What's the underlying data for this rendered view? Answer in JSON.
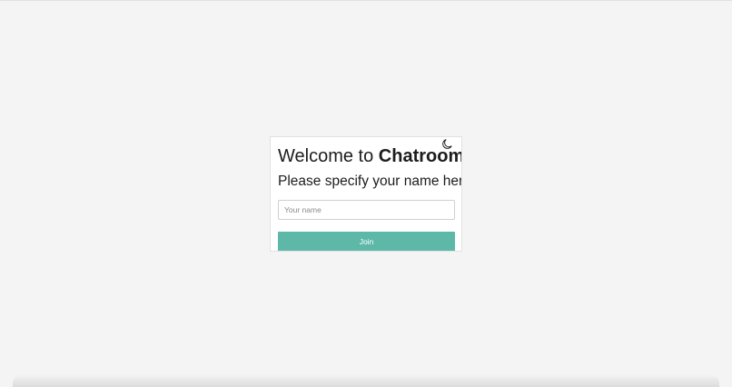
{
  "login_card": {
    "heading_prefix": "Welcome to ",
    "heading_brand": "Chatroom",
    "heading_suffix": "!",
    "subtitle": "Please specify your name here:",
    "name_input": {
      "value": "",
      "placeholder": "Your name"
    },
    "join_label": "Join",
    "theme_toggle_icon": "moon-icon"
  },
  "colors": {
    "page_background": "#f4f4f4",
    "card_background": "#ffffff",
    "accent": "#5eb8a8",
    "text": "#1c1c1c"
  }
}
